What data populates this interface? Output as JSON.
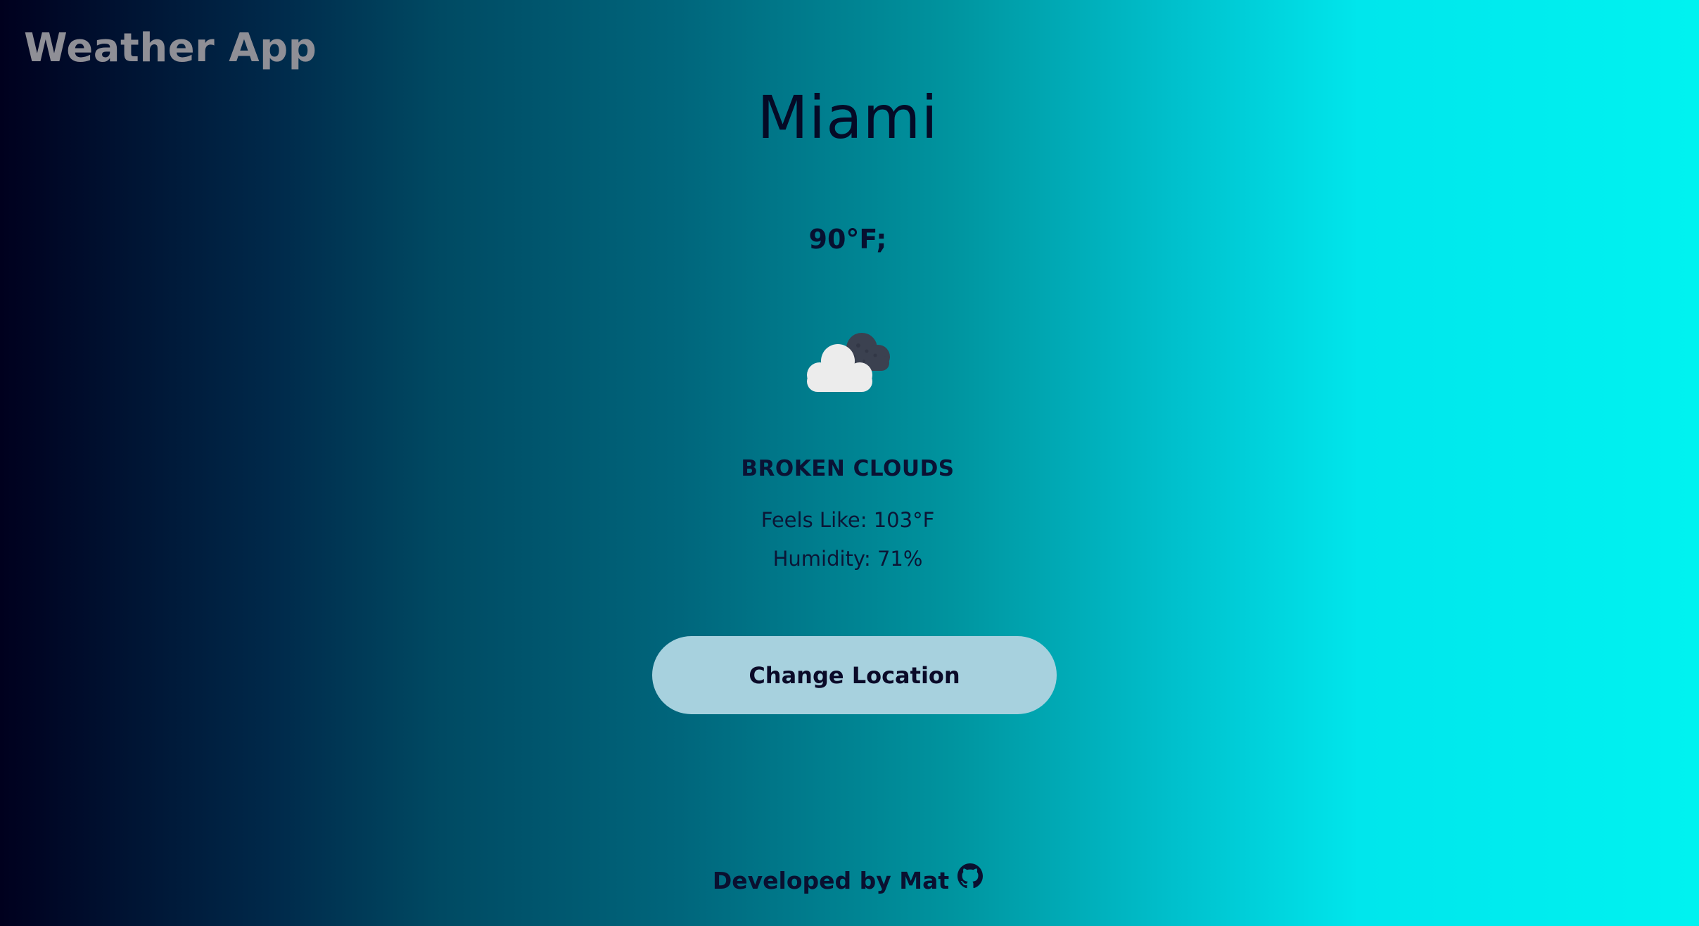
{
  "header": {
    "app_title": "Weather App"
  },
  "weather": {
    "city": "Miami",
    "temperature": "90°F;",
    "icon": "broken-clouds-icon",
    "condition": "BROKEN CLOUDS",
    "feels_like": "Feels Like: 103°F",
    "humidity": "Humidity: 71%"
  },
  "actions": {
    "change_location_label": "Change Location"
  },
  "footer": {
    "credit": "Developed by Mat",
    "link_icon": "github-icon"
  },
  "colors": {
    "background_gradient_start": "#00001e",
    "background_gradient_end": "#00f2f0",
    "button_bg": "#a7d1de",
    "title_color": "#8f8f96"
  }
}
